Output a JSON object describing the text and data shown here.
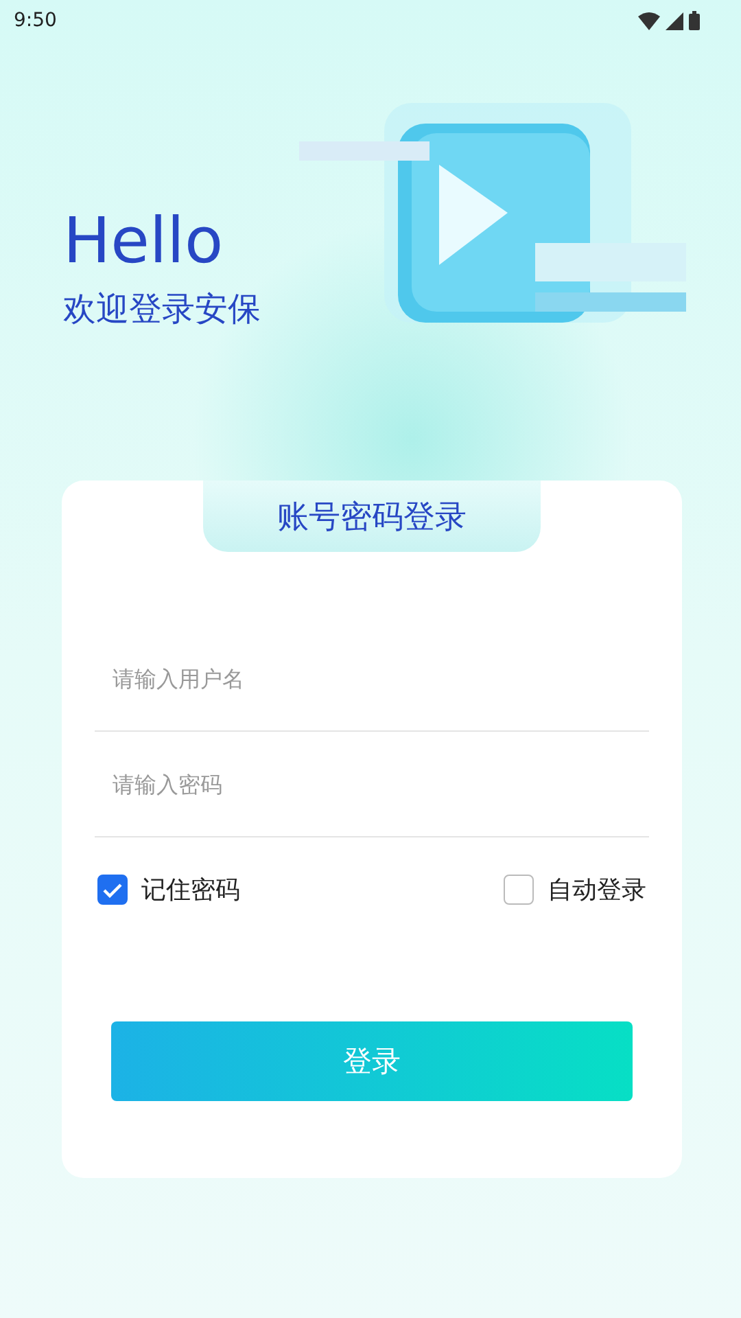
{
  "status_bar": {
    "time": "9:50"
  },
  "hero": {
    "greeting": "Hello",
    "subtitle": "欢迎登录安保"
  },
  "card": {
    "tab": "账号密码登录",
    "fields": [
      {
        "placeholder": "请输入用户名"
      },
      {
        "placeholder": "请输入密码"
      }
    ],
    "options": [
      {
        "label": "记住密码",
        "checked": true
      },
      {
        "label": "自动登录",
        "checked": false
      }
    ],
    "submit": "登录"
  }
}
